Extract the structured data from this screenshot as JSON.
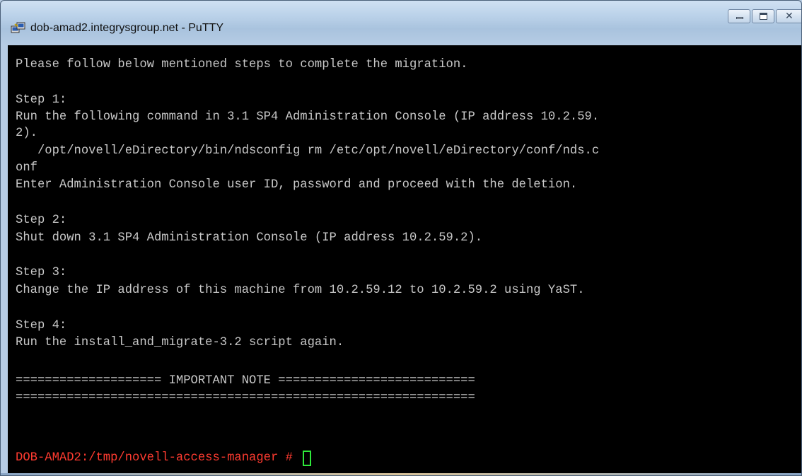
{
  "window": {
    "title": "dob-amad2.integrysgroup.net - PuTTY",
    "icon": "putty-icon",
    "buttons": {
      "minimize": "minimize-icon",
      "maximize": "maximize-icon",
      "close": "close-icon"
    }
  },
  "terminal": {
    "lines": [
      "Please follow below mentioned steps to complete the migration.",
      "",
      "Step 1:",
      "Run the following command in 3.1 SP4 Administration Console (IP address 10.2.59.",
      "2).",
      "   /opt/novell/eDirectory/bin/ndsconfig rm /etc/opt/novell/eDirectory/conf/nds.c",
      "onf",
      "Enter Administration Console user ID, password and proceed with the deletion.",
      "",
      "Step 2:",
      "Shut down 3.1 SP4 Administration Console (IP address 10.2.59.2).",
      "",
      "Step 3:",
      "Change the IP address of this machine from 10.2.59.12 to 10.2.59.2 using YaST.",
      "",
      "Step 4:",
      "Run the install_and_migrate-3.2 script again.",
      "",
      "==================== IMPORTANT NOTE ===========================",
      "==============================================================="
    ],
    "prompt": "DOB-AMAD2:/tmp/novell-access-manager # ",
    "colors": {
      "background": "#000000",
      "text": "#c8c8c8",
      "prompt": "#ff3b30",
      "cursor": "#2ee83a"
    }
  }
}
